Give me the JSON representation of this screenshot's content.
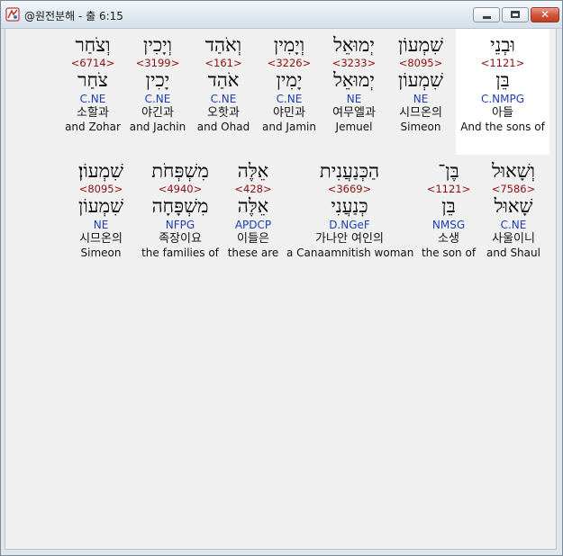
{
  "window": {
    "title": "@원전분해 - 출 6:15",
    "icon": "app-icon",
    "buttons": {
      "minimize": "minimize-icon",
      "maximize": "maximize-icon",
      "close": "✕"
    }
  },
  "rows": [
    {
      "words": [
        {
          "hebrew": "וּבְנֵי",
          "strong": "<1121>",
          "lemma": "בֵּן",
          "morph": "C.NMPG",
          "korean": "아들",
          "english": "And the sons of",
          "selected": true
        },
        {
          "hebrew": "שִׁמְעוֹן",
          "strong": "<8095>",
          "lemma": "שִׁמְעוֹן",
          "morph": "NE",
          "korean": "시므온의",
          "english": "Simeon"
        },
        {
          "hebrew": "יְמוּאֵל",
          "strong": "<3233>",
          "lemma": "יְמוּאֵל",
          "morph": "NE",
          "korean": "여무엘과",
          "english": "Jemuel"
        },
        {
          "hebrew": "וְיָמִין",
          "strong": "<3226>",
          "lemma": "יָמִין",
          "morph": "C.NE",
          "korean": "야민과",
          "english": "and Jamin"
        },
        {
          "hebrew": "וְאֹהַד",
          "strong": "<161>",
          "lemma": "אֹהַד",
          "morph": "C.NE",
          "korean": "오핫과",
          "english": "and Ohad"
        },
        {
          "hebrew": "וְיָכִין",
          "strong": "<3199>",
          "lemma": "יָכִין",
          "morph": "C.NE",
          "korean": "야긴과",
          "english": "and Jachin"
        },
        {
          "hebrew": "וְצֹחַר",
          "strong": "<6714>",
          "lemma": "צֹחַר",
          "morph": "C.NE",
          "korean": "소할과",
          "english": "and Zohar"
        }
      ]
    },
    {
      "words": [
        {
          "hebrew": "וְשָׁאוּל",
          "strong": "<7586>",
          "lemma": "שָׁאוּל",
          "morph": "C.NE",
          "korean": "사울이니",
          "english": "and Shaul"
        },
        {
          "hebrew": "בֶּן־",
          "strong": "<1121>",
          "lemma": "בֵּן",
          "morph": "NMSG",
          "korean": "소생",
          "english": "the son of"
        },
        {
          "hebrew": "הַכְּנַעֲנִית",
          "strong": "<3669>",
          "lemma": "כְּנַעֲנִי",
          "morph": "D.NGeF",
          "korean": "가나안 여인의",
          "english": "a Canaamnitish woman"
        },
        {
          "hebrew": "אֵלֶּה",
          "strong": "<428>",
          "lemma": "אֵלֶּה",
          "morph": "APDCP",
          "korean": "이들은",
          "english": "these are"
        },
        {
          "hebrew": "מִשְׁפְּחֹת",
          "strong": "<4940>",
          "lemma": "מִשְׁפָּחָה",
          "morph": "NFPG",
          "korean": "족장이요",
          "english": "the families of"
        },
        {
          "hebrew": "שִׁמְעוֹן׃",
          "strong": "<8095>",
          "lemma": "שִׁמְעוֹן",
          "morph": "NE",
          "korean": "시므온의",
          "english": "Simeon"
        }
      ]
    }
  ]
}
